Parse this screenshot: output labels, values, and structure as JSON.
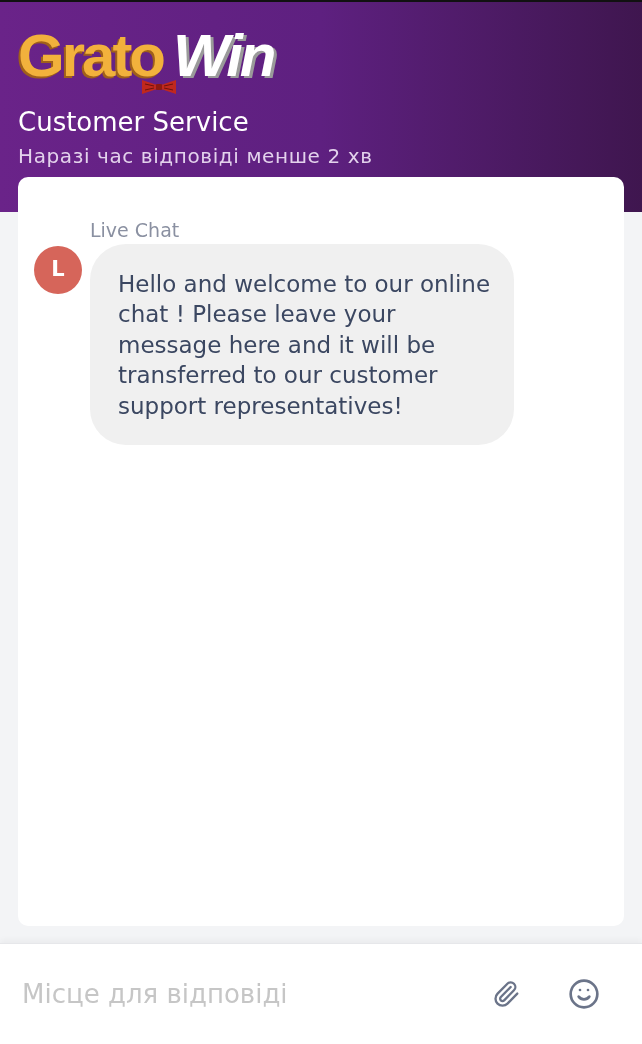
{
  "header": {
    "logo": {
      "first_word": "Grato",
      "second_word": "Win"
    },
    "title": "Customer Service",
    "subtitle": "Наразі час відповіді менше 2 хв"
  },
  "chat": {
    "messages": [
      {
        "sender": "Live Chat",
        "avatar": "L",
        "text": "Hello and welcome to our online chat ! Please leave your message here and it will be transferred to our customer support representatives!"
      }
    ]
  },
  "composer": {
    "placeholder": "Місце для відповіді"
  }
}
